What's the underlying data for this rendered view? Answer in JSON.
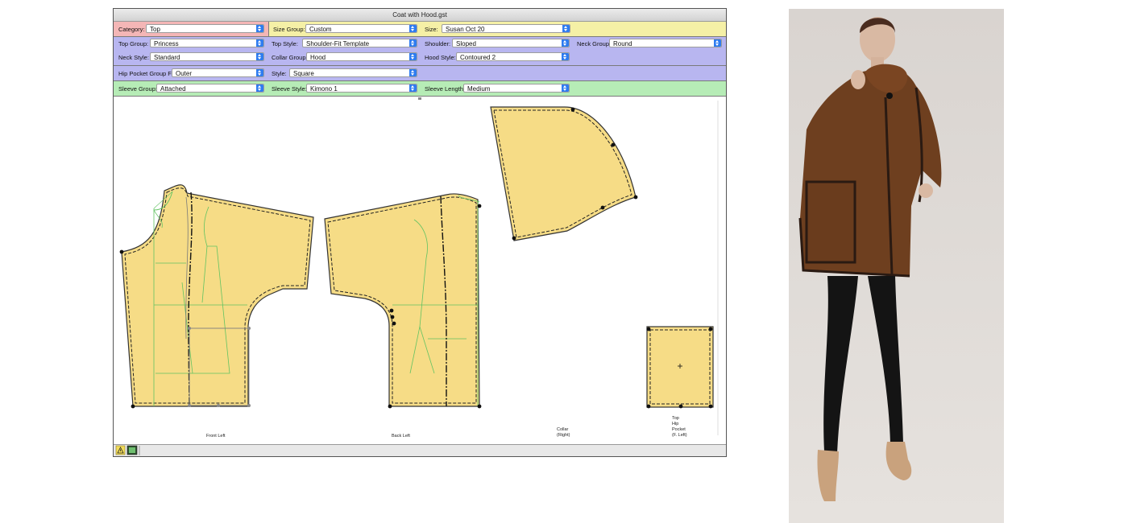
{
  "window": {
    "title": "Coat with Hood.gst"
  },
  "rows": [
    {
      "color": "mixed",
      "fields": [
        {
          "label": "Category:",
          "value": "Top"
        },
        {
          "label": "Size Group:",
          "value": "Custom"
        },
        {
          "label": "Size:",
          "value": "Susan Oct 20"
        }
      ]
    },
    {
      "fields": [
        {
          "label": "Top Group:",
          "value": "Princess"
        },
        {
          "label": "Top Style:",
          "value": "Shoulder-Fit Template"
        },
        {
          "label": "Shoulder:",
          "value": "Sloped"
        },
        {
          "label": "Neck Group:",
          "value": "Round"
        },
        {
          "label": "Neck Style:",
          "value": "Standard"
        },
        {
          "label": "Collar Group:",
          "value": "Hood"
        },
        {
          "label": "Hood Style:",
          "value": "Contoured 2"
        }
      ]
    },
    {
      "fields": [
        {
          "label": "Hip Pocket Group F:",
          "value": "Outer"
        },
        {
          "label": "Style:",
          "value": "Square"
        }
      ]
    },
    {
      "fields": [
        {
          "label": "Sleeve Group:",
          "value": "Attached"
        },
        {
          "label": "Sleeve Style:",
          "value": "Kimono 1"
        },
        {
          "label": "Sleeve Length:",
          "value": "Medium"
        }
      ]
    }
  ],
  "pieces": {
    "front_left": "Front Left",
    "back_left": "Back Left",
    "collar_line1": "Collar",
    "collar_line2": "(Right)",
    "pocket_line1": "Top",
    "pocket_line2": "Hip",
    "pocket_line3": "Pocket",
    "pocket_line4": "(F. Left)"
  },
  "colors": {
    "category_bg": "#f4b6b6",
    "size_bg": "#f5f0a6",
    "style_bg": "#b8b6f0",
    "sleeve_bg": "#b6ecb6",
    "piece_fill": "#f6dc86",
    "guide_line": "#62c362",
    "accent": "#2f7cf0"
  },
  "icons": [
    "warning-icon",
    "thumbnail-icon"
  ]
}
